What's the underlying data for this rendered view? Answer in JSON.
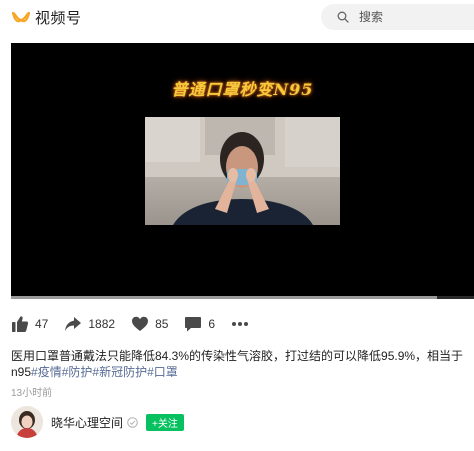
{
  "header": {
    "app_name": "视频号",
    "logo_icon": "channels-logo-icon",
    "brand_color": "#f5a623",
    "search_placeholder": "搜索"
  },
  "video": {
    "overlay_title": "普通口罩秒变N95",
    "progress_fraction": 0.92
  },
  "actions": {
    "likes": "47",
    "shares": "1882",
    "favorites": "85",
    "comments": "6"
  },
  "post": {
    "caption_line1": "医用口罩普通戴法只能降低84.3%的传染性气溶胶，打过结的可以降低95.9%，相当于",
    "caption_prefix": "n95",
    "tags": [
      "#疫情",
      "#防护",
      "#新冠防护",
      "#口罩"
    ],
    "time": "13小时前"
  },
  "author": {
    "name": "晓华心理空间",
    "follow_label": "+关注",
    "follow_color": "#07c160"
  }
}
